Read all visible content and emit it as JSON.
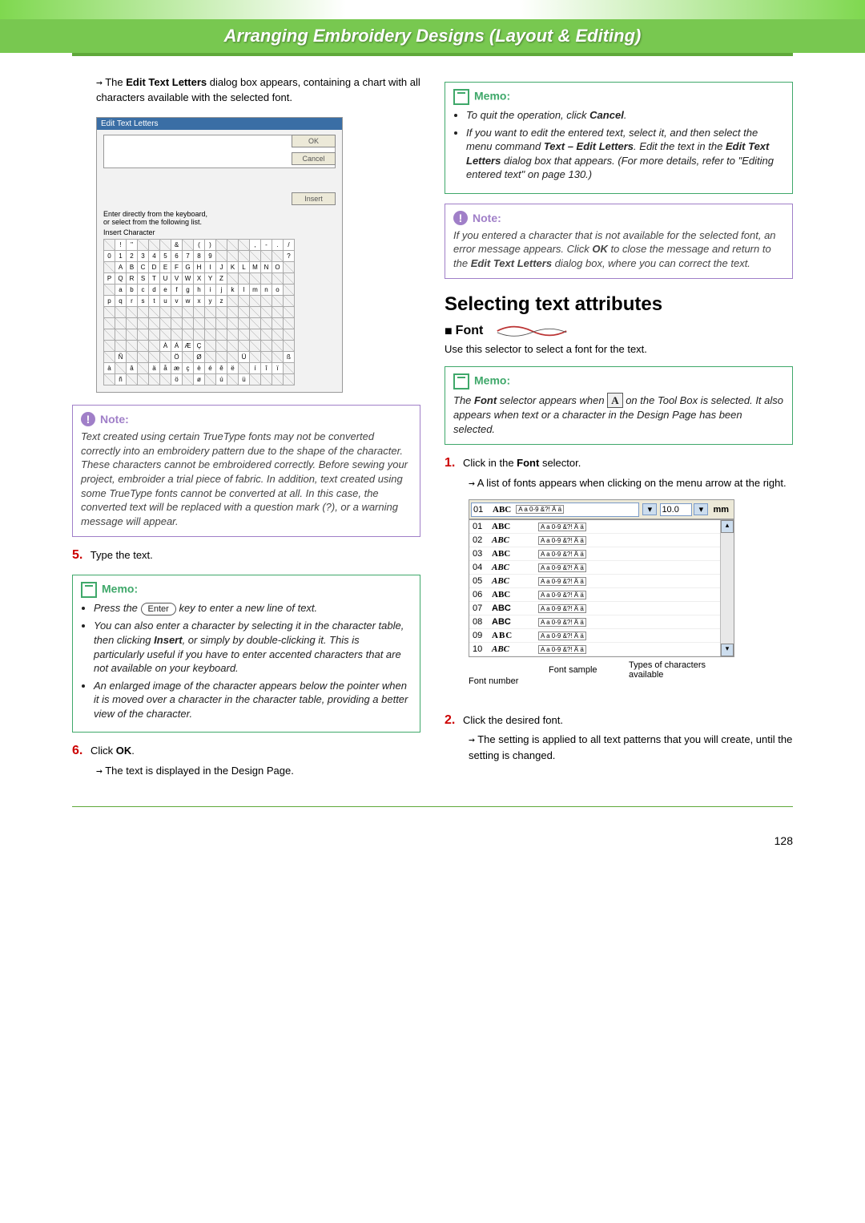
{
  "header": {
    "title": "Arranging Embroidery Designs (Layout & Editing)"
  },
  "left": {
    "intro_arrow": "→",
    "intro": "The Edit Text Letters dialog box appears, containing a chart with all characters available with the selected font.",
    "intro_bold": "Edit Text Letters",
    "dialog": {
      "title": "Edit Text Letters",
      "ok": "OK",
      "cancel": "Cancel",
      "insert": "Insert",
      "hint1": "Enter directly from the keyboard,",
      "hint2": "or select from the following list.",
      "insert_char": "Insert Character"
    },
    "char_rows": [
      [
        "",
        "!",
        "\"",
        "",
        "",
        "",
        "&",
        "",
        "(",
        ")",
        "",
        "",
        "",
        ",",
        "-",
        ".",
        "/"
      ],
      [
        "0",
        "1",
        "2",
        "3",
        "4",
        "5",
        "6",
        "7",
        "8",
        "9",
        "",
        "",
        "",
        "",
        "",
        "",
        "?"
      ],
      [
        "",
        "A",
        "B",
        "C",
        "D",
        "E",
        "F",
        "G",
        "H",
        "I",
        "J",
        "K",
        "L",
        "M",
        "N",
        "O",
        ""
      ],
      [
        "P",
        "Q",
        "R",
        "S",
        "T",
        "U",
        "V",
        "W",
        "X",
        "Y",
        "Z",
        "",
        "",
        "",
        "",
        "",
        ""
      ],
      [
        "",
        "a",
        "b",
        "c",
        "d",
        "e",
        "f",
        "g",
        "h",
        "i",
        "j",
        "k",
        "l",
        "m",
        "n",
        "o",
        ""
      ],
      [
        "p",
        "q",
        "r",
        "s",
        "t",
        "u",
        "v",
        "w",
        "x",
        "y",
        "z",
        "",
        "",
        "",
        "",
        "",
        ""
      ],
      [
        "",
        "",
        "",
        "",
        "",
        "",
        "",
        "",
        "",
        "",
        "",
        "",
        "",
        "",
        "",
        "",
        ""
      ],
      [
        "",
        "",
        "",
        "",
        "",
        "",
        "",
        "",
        "",
        "",
        "",
        "",
        "",
        "",
        "",
        "",
        ""
      ],
      [
        "",
        "",
        "",
        "",
        "",
        "",
        "",
        "",
        "",
        "",
        "",
        "",
        "",
        "",
        "",
        "",
        ""
      ],
      [
        "",
        "",
        "",
        "",
        "",
        "À",
        "Á",
        "Æ",
        "Ç",
        "",
        "",
        "",
        "",
        "",
        "",
        "",
        ""
      ],
      [
        "",
        "Ñ",
        "",
        "",
        "",
        "",
        "Ö",
        "",
        "Ø",
        "",
        "",
        "",
        "Ü",
        "",
        "",
        "",
        "ß"
      ],
      [
        "à",
        "",
        "â",
        "",
        "ä",
        "å",
        "æ",
        "ç",
        "è",
        "é",
        "ê",
        "ë",
        "",
        "í",
        "î",
        "ï",
        ""
      ],
      [
        "",
        "ñ",
        "",
        "",
        "",
        "",
        "ö",
        "",
        "ø",
        "",
        "ú",
        "",
        "ü",
        "",
        "",
        "",
        ""
      ]
    ],
    "note1": {
      "label": "Note:",
      "body": "Text created using certain TrueType fonts may not be converted correctly into an embroidery pattern due to the shape of the character. These characters cannot be embroidered correctly. Before sewing your project, embroider a trial piece of fabric. In addition, text created using some TrueType fonts cannot be converted at all. In this case, the converted text will be replaced with a question mark (?), or a warning message will appear."
    },
    "step5_num": "5.",
    "step5_text": "Type the text.",
    "memo1": {
      "label": "Memo:",
      "b1a": "Press the ",
      "b1_key": "Enter",
      "b1b": " key to enter a new line of text.",
      "b2": "You can also enter a character by selecting it in the character table, then clicking Insert, or simply by double-clicking it. This is particularly useful if you have to enter accented characters that are not available on your keyboard.",
      "b2_bold": "Insert",
      "b3": "An enlarged image of the character appears below the pointer when it is moved over a character in the character table, providing a better view of the character."
    },
    "step6_num": "6.",
    "step6_text_a": "Click ",
    "step6_text_b": "OK",
    "step6_text_c": ".",
    "step6_res_arrow": "→",
    "step6_res": "The text is displayed in the Design Page."
  },
  "right": {
    "memo_top": {
      "label": "Memo:",
      "b1a": "To quit the operation, click ",
      "b1b": "Cancel",
      "b1c": ".",
      "b2": "If you want to edit the entered text, select it, and then select the menu command Text – Edit Letters. Edit the text in the Edit Text Letters dialog box that appears. (For more details, refer to \"Editing entered text\" on page 130.)",
      "b2_bold1": "Text – Edit Letters",
      "b2_bold2": "Edit Text Letters"
    },
    "note2": {
      "label": "Note:",
      "body": "If you entered a character that is not available for the selected font, an error message appears. Click OK to close the message and return to the Edit Text Letters dialog box, where you can correct the text.",
      "bold1": "OK",
      "bold2": "Edit Text Letters"
    },
    "h2": "Selecting text attributes",
    "h3": "Font",
    "h3_desc": "Use this selector to select a font for the text.",
    "memo_font": {
      "label": "Memo:",
      "t1": "The Font selector appears when ",
      "t1_bold": "Font",
      "icon": "A",
      "t2": " on the Tool Box is selected. It also appears when text or a character in the Design Page has been selected."
    },
    "step1_num": "1.",
    "step1_a": "Click in the ",
    "step1_b": "Font",
    "step1_c": " selector.",
    "step1_res_arrow": "→",
    "step1_res": "A list of fonts appears when clicking on the menu arrow at the right.",
    "dd": {
      "sel_num": "01",
      "sel_abc": "ABC",
      "sel_chars": "A a 0-9 &?! Ä ä",
      "size": "10.0",
      "unit": "mm",
      "rows": [
        {
          "n": "01",
          "abc": "ABC",
          "style": "bold",
          "chars": "A a 0-9 &?! Ä ä"
        },
        {
          "n": "02",
          "abc": "ABC",
          "style": "script",
          "chars": "A a 0-9 &?! Ä ä"
        },
        {
          "n": "03",
          "abc": "ABC",
          "style": "black",
          "chars": "A a 0-9 &?! Ä ä"
        },
        {
          "n": "04",
          "abc": "ABC",
          "style": "italic",
          "chars": "A a 0-9 &?! Ä ä"
        },
        {
          "n": "05",
          "abc": "ABC",
          "style": "bolditalic",
          "chars": "A a 0-9 &?! Ä ä"
        },
        {
          "n": "06",
          "abc": "ABC",
          "style": "bold",
          "chars": "A a 0-9 &?! Ä ä"
        },
        {
          "n": "07",
          "abc": "ABC",
          "style": "sans",
          "chars": "A a 0-9 &?! Ä ä"
        },
        {
          "n": "08",
          "abc": "ABC",
          "style": "sans",
          "chars": "A a 0-9 &?! Ä ä"
        },
        {
          "n": "09",
          "abc": "ABC",
          "style": "fancy",
          "chars": "A a 0-9 &?! Ä ä"
        },
        {
          "n": "10",
          "abc": "ABC",
          "style": "bolditalic",
          "chars": "A a 0-9 &?! Ä ä"
        }
      ],
      "cl_fontnum": "Font number",
      "cl_sample": "Font sample",
      "cl_types": "Types of characters available"
    },
    "step2_num": "2.",
    "step2_text": "Click the desired font.",
    "step2_res_arrow": "→",
    "step2_res": "The setting is applied to all text patterns that you will create, until the setting is changed."
  },
  "page_number": "128"
}
